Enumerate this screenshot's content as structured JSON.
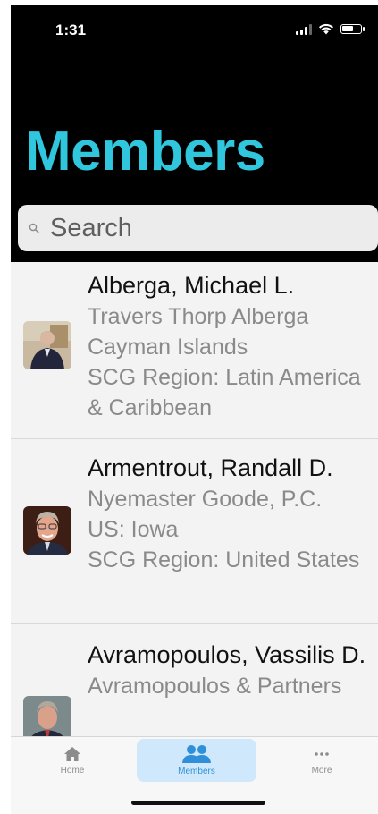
{
  "status": {
    "time": "1:31"
  },
  "header": {
    "title": "Members"
  },
  "search": {
    "placeholder": "Search"
  },
  "members": [
    {
      "name": "Alberga, Michael L.",
      "firm": "Travers Thorp Alberga",
      "location": "Cayman Islands",
      "region": "SCG Region:  Latin America & Caribbean"
    },
    {
      "name": "Armentrout, Randall D.",
      "firm": "Nyemaster Goode, P.C.",
      "location": "US: Iowa",
      "region": "SCG Region:  United States"
    },
    {
      "name": "Avramopoulos, Vassilis D.",
      "firm": "Avramopoulos & Partners"
    }
  ],
  "tabbar": {
    "items": [
      {
        "label": "Home",
        "icon": "house-icon"
      },
      {
        "label": "Members",
        "icon": "people-icon",
        "active": true
      },
      {
        "label": "More",
        "icon": "ellipsis-icon"
      }
    ]
  },
  "colors": {
    "accent": "#2fc6de",
    "tab_active_bg": "#cfe8fb",
    "tab_active_fg": "#2f8fd8"
  }
}
